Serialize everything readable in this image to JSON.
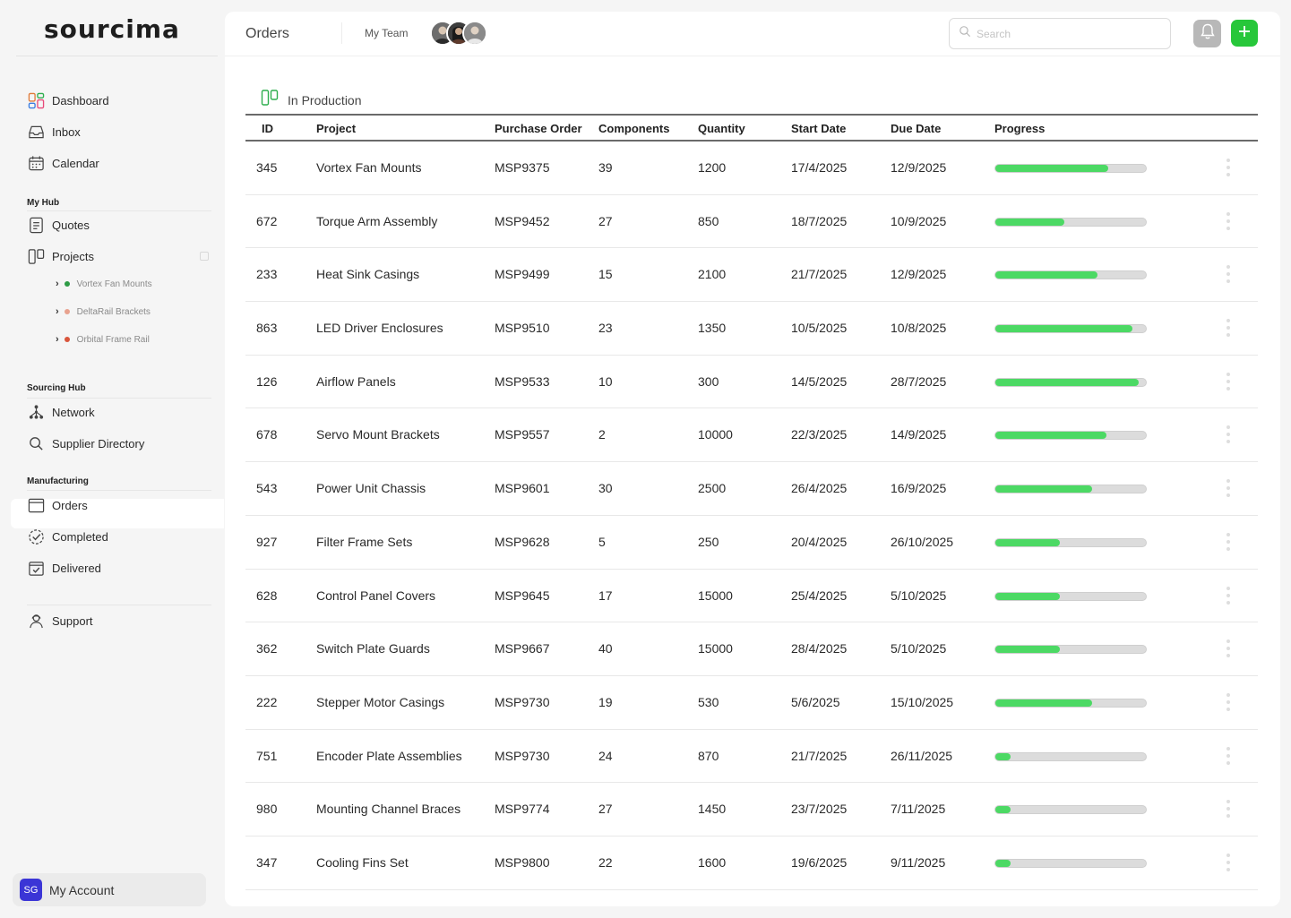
{
  "brand": {
    "logo_text": "sourcima"
  },
  "sidebar": {
    "top_items": [
      {
        "label": "Dashboard",
        "icon": "dashboard-icon"
      },
      {
        "label": "Inbox",
        "icon": "inbox-icon"
      },
      {
        "label": "Calendar",
        "icon": "calendar-icon"
      }
    ],
    "my_hub": {
      "title": "My Hub",
      "items": [
        {
          "label": "Quotes",
          "icon": "quotes-icon"
        },
        {
          "label": "Projects",
          "icon": "projects-icon"
        }
      ],
      "projects": [
        {
          "label": "Vortex Fan Mounts",
          "dot_color": "#2e9b45"
        },
        {
          "label": "DeltaRail Brackets",
          "dot_color": "#e8a28f"
        },
        {
          "label": "Orbital Frame Rail",
          "dot_color": "#d9553b"
        }
      ]
    },
    "sourcing_hub": {
      "title": "Sourcing Hub",
      "items": [
        {
          "label": "Network",
          "icon": "network-icon"
        },
        {
          "label": "Supplier Directory",
          "icon": "search-icon"
        }
      ]
    },
    "manufacturing": {
      "title": "Manufacturing",
      "items": [
        {
          "label": "Orders",
          "icon": "orders-icon",
          "active": true
        },
        {
          "label": "Completed",
          "icon": "completed-icon"
        },
        {
          "label": "Delivered",
          "icon": "delivered-icon"
        }
      ]
    },
    "support": {
      "label": "Support",
      "icon": "support-icon"
    },
    "account": {
      "initials": "SG",
      "label": "My Account",
      "avatar_color": "#3b35d6"
    }
  },
  "header": {
    "title": "Orders",
    "team_label": "My Team",
    "search_placeholder": "Search",
    "accent_color": "#27c73a"
  },
  "section": {
    "title": "In Production"
  },
  "table": {
    "columns": [
      "ID",
      "Project",
      "Purchase Order",
      "Components",
      "Quantity",
      "Start Date",
      "Due Date",
      "Progress"
    ],
    "rows": [
      {
        "id": "345",
        "project": "Vortex Fan Mounts",
        "po": "MSP9375",
        "components": "39",
        "quantity": "1200",
        "start": "17/4/2025",
        "due": "12/9/2025",
        "progress": 0.75
      },
      {
        "id": "672",
        "project": "Torque Arm Assembly",
        "po": "MSP9452",
        "components": "27",
        "quantity": "850",
        "start": "18/7/2025",
        "due": "10/9/2025",
        "progress": 0.46
      },
      {
        "id": "233",
        "project": "Heat Sink Casings",
        "po": "MSP9499",
        "components": "15",
        "quantity": "2100",
        "start": "21/7/2025",
        "due": "12/9/2025",
        "progress": 0.68
      },
      {
        "id": "863",
        "project": "LED Driver Enclosures",
        "po": "MSP9510",
        "components": "23",
        "quantity": "1350",
        "start": "10/5/2025",
        "due": "10/8/2025",
        "progress": 0.91
      },
      {
        "id": "126",
        "project": "Airflow Panels",
        "po": "MSP9533",
        "components": "10",
        "quantity": "300",
        "start": "14/5/2025",
        "due": "28/7/2025",
        "progress": 0.95
      },
      {
        "id": "678",
        "project": "Servo Mount Brackets",
        "po": "MSP9557",
        "components": "2",
        "quantity": "10000",
        "start": "22/3/2025",
        "due": "14/9/2025",
        "progress": 0.74
      },
      {
        "id": "543",
        "project": "Power Unit Chassis",
        "po": "MSP9601",
        "components": "30",
        "quantity": "2500",
        "start": "26/4/2025",
        "due": "16/9/2025",
        "progress": 0.64
      },
      {
        "id": "927",
        "project": "Filter Frame Sets",
        "po": "MSP9628",
        "components": "5",
        "quantity": "250",
        "start": "20/4/2025",
        "due": "26/10/2025",
        "progress": 0.43
      },
      {
        "id": "628",
        "project": "Control Panel Covers",
        "po": "MSP9645",
        "components": "17",
        "quantity": "15000",
        "start": "25/4/2025",
        "due": "5/10/2025",
        "progress": 0.43
      },
      {
        "id": "362",
        "project": "Switch Plate Guards",
        "po": "MSP9667",
        "components": "40",
        "quantity": "15000",
        "start": "28/4/2025",
        "due": "5/10/2025",
        "progress": 0.43
      },
      {
        "id": "222",
        "project": "Stepper Motor Casings",
        "po": "MSP9730",
        "components": "19",
        "quantity": "530",
        "start": "5/6/2025",
        "due": "15/10/2025",
        "progress": 0.64
      },
      {
        "id": "751",
        "project": "Encoder Plate Assemblies",
        "po": "MSP9730",
        "components": "24",
        "quantity": "870",
        "start": "21/7/2025",
        "due": "26/11/2025",
        "progress": 0.1
      },
      {
        "id": "980",
        "project": "Mounting Channel Braces",
        "po": "MSP9774",
        "components": "27",
        "quantity": "1450",
        "start": "23/7/2025",
        "due": "7/11/2025",
        "progress": 0.1
      },
      {
        "id": "347",
        "project": "Cooling Fins Set",
        "po": "MSP9800",
        "components": "22",
        "quantity": "1600",
        "start": "19/6/2025",
        "due": "9/11/2025",
        "progress": 0.1
      }
    ]
  }
}
